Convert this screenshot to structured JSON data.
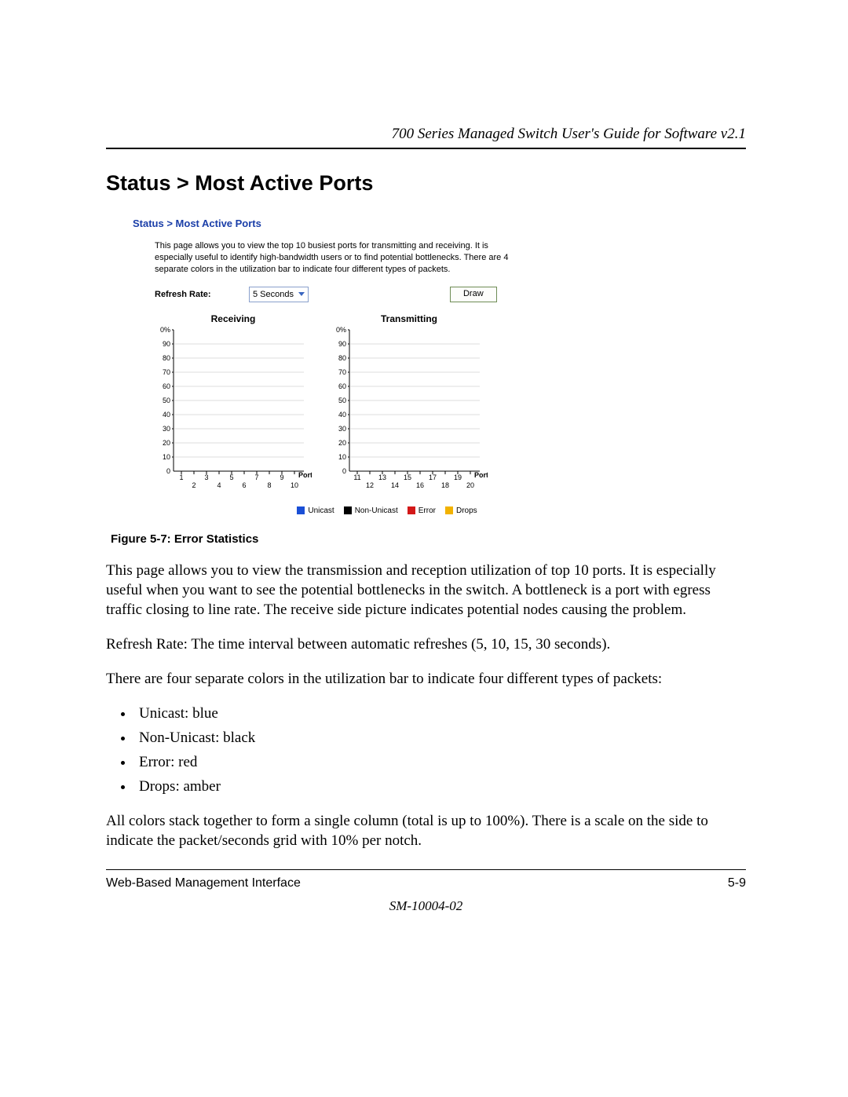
{
  "header": {
    "doc_title": "700 Series Managed Switch User's Guide for Software v2.1"
  },
  "section": {
    "heading": "Status > Most Active Ports"
  },
  "ui": {
    "breadcrumb": "Status > Most Active Ports",
    "description": "This page allows you to view the top 10 busiest ports for transmitting and receiving. It is especially useful to identify high-bandwidth users or to find potential bottlenecks. There are 4 separate colors in the utilization bar to indicate four different types of packets.",
    "refresh_label": "Refresh Rate:",
    "refresh_value": "5 Seconds",
    "draw_button": "Draw",
    "receiving_title": "Receiving",
    "transmitting_title": "Transmitting",
    "axis_label": "Port",
    "legend": {
      "unicast": "Unicast",
      "non_unicast": "Non-Unicast",
      "error": "Error",
      "drops": "Drops"
    },
    "colors": {
      "unicast": "#1a4fd6",
      "non_unicast": "#000000",
      "error": "#d31818",
      "drops": "#f2b200"
    }
  },
  "figure_caption": "Figure 5-7:  Error Statistics",
  "paragraphs": {
    "p1": "This page allows you to view the transmission and reception utilization of top 10 ports. It is especially useful when you want to see the potential bottlenecks in the switch. A bottleneck is a port with egress traffic closing to line rate. The receive side picture indicates potential nodes causing the problem.",
    "p2a": "Refresh Rate",
    "p2b": ": The time interval between automatic refreshes (5, 10, 15, 30 seconds).",
    "p3": "There are four separate colors in the utilization bar to indicate four different types of packets:",
    "li1": "Unicast: blue",
    "li2": "Non-Unicast: black",
    "li3": "Error: red",
    "li4": "Drops: amber",
    "p4": "All colors stack together to form a single column (total is up to 100%). There is a scale on the side to indicate the packet/seconds grid with 10% per notch."
  },
  "footer": {
    "left": "Web-Based Management Interface",
    "right": "5-9",
    "code": "SM-10004-02"
  },
  "chart_data": [
    {
      "type": "bar",
      "title": "Receiving",
      "xlabel": "Port",
      "ylabel": "",
      "ylim": [
        0,
        100
      ],
      "y_ticks": [
        "0",
        "10",
        "20",
        "30",
        "40",
        "50",
        "60",
        "70",
        "80",
        "90",
        "0%"
      ],
      "categories": [
        "1",
        "2",
        "3",
        "4",
        "5",
        "6",
        "7",
        "8",
        "9",
        "10"
      ],
      "series": [
        {
          "name": "Unicast",
          "values": [
            0,
            0,
            0,
            0,
            0,
            0,
            0,
            0,
            0,
            0
          ]
        },
        {
          "name": "Non-Unicast",
          "values": [
            0,
            0,
            0,
            0,
            0,
            0,
            0,
            0,
            0,
            0
          ]
        },
        {
          "name": "Error",
          "values": [
            0,
            0,
            0,
            0,
            0,
            0,
            0,
            0,
            0,
            0
          ]
        },
        {
          "name": "Drops",
          "values": [
            0,
            0,
            0,
            0,
            0,
            0,
            0,
            0,
            0,
            0
          ]
        }
      ]
    },
    {
      "type": "bar",
      "title": "Transmitting",
      "xlabel": "Port",
      "ylabel": "",
      "ylim": [
        0,
        100
      ],
      "y_ticks": [
        "0",
        "10",
        "20",
        "30",
        "40",
        "50",
        "60",
        "70",
        "80",
        "90",
        "0%"
      ],
      "categories": [
        "11",
        "12",
        "13",
        "14",
        "15",
        "16",
        "17",
        "18",
        "19",
        "20"
      ],
      "series": [
        {
          "name": "Unicast",
          "values": [
            0,
            0,
            0,
            0,
            0,
            0,
            0,
            0,
            0,
            0
          ]
        },
        {
          "name": "Non-Unicast",
          "values": [
            0,
            0,
            0,
            0,
            0,
            0,
            0,
            0,
            0,
            0
          ]
        },
        {
          "name": "Error",
          "values": [
            0,
            0,
            0,
            0,
            0,
            0,
            0,
            0,
            0,
            0
          ]
        },
        {
          "name": "Drops",
          "values": [
            0,
            0,
            0,
            0,
            0,
            0,
            0,
            0,
            0,
            0
          ]
        }
      ]
    }
  ]
}
